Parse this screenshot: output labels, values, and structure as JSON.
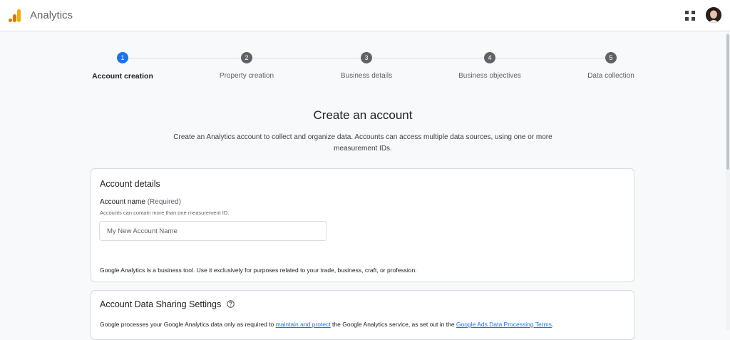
{
  "header": {
    "app_title": "Analytics",
    "icons": {
      "logo": "analytics-logo",
      "apps": "apps-grid-icon",
      "avatar": "user-avatar"
    },
    "brand_colors": {
      "logo_light": "#f9ab00",
      "logo_dark": "#e37400"
    }
  },
  "stepper": {
    "active_color": "#1a73e8",
    "steps": [
      {
        "number": "1",
        "label": "Account creation",
        "active": true
      },
      {
        "number": "2",
        "label": "Property creation",
        "active": false
      },
      {
        "number": "3",
        "label": "Business details",
        "active": false
      },
      {
        "number": "4",
        "label": "Business objectives",
        "active": false
      },
      {
        "number": "5",
        "label": "Data collection",
        "active": false
      }
    ]
  },
  "intro": {
    "title": "Create an account",
    "description": "Create an Analytics account to collect and organize data. Accounts can access multiple data sources, using one or more measurement IDs."
  },
  "account_details": {
    "title": "Account details",
    "field_label": "Account name",
    "field_required": "(Required)",
    "field_hint": "Accounts can contain more than one measurement ID.",
    "input_placeholder": "My New Account Name",
    "input_value": "",
    "business_note": "Google Analytics is a business tool. Use it exclusively for purposes related to your trade, business, craft, or profession."
  },
  "sharing": {
    "title": "Account Data Sharing Settings",
    "help_icon": "help-circle-icon",
    "text_before": "Google processes your Google Analytics data only as required to ",
    "link1": "maintain and protect",
    "text_middle": " the Google Analytics service, as set out in the ",
    "link2": "Google Ads Data Processing Terms",
    "text_after": "."
  }
}
